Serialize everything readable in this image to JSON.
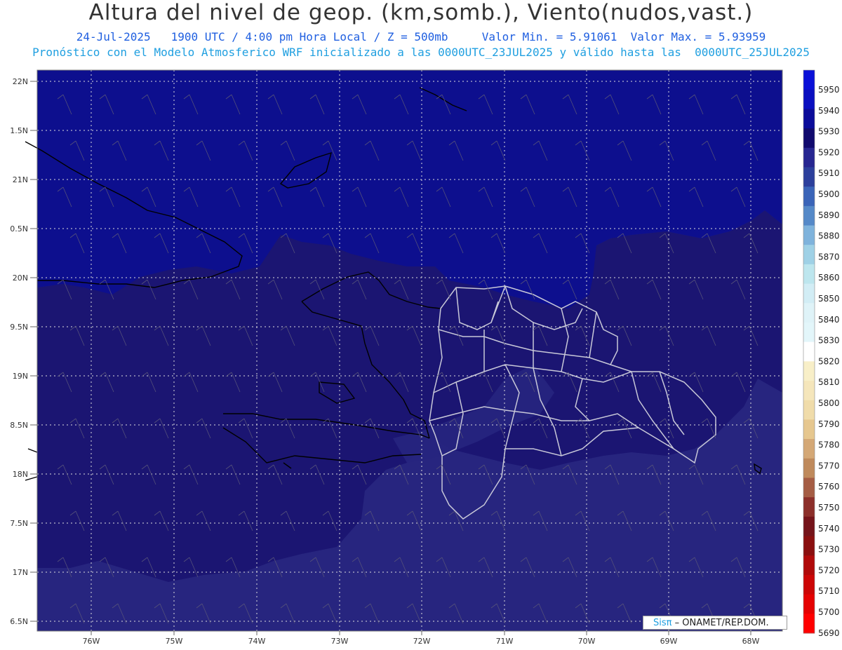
{
  "header": {
    "title": "Altura del nivel de geop. (km,somb.), Viento(nudos,vast.)",
    "line1_date": "24-Jul-2025",
    "line1_time": "1900 UTC / 4:00 pm Hora Local / Z = 500mb",
    "line1_min": "Valor Min. = 5.91061",
    "line1_max": "Valor Max. = 5.93959",
    "line2": "Pronóstico con el Modelo Atmosferico WRF inicializado a las 0000UTC_23JUL2025 y válido hasta las  0000UTC_25JUL2025"
  },
  "axes": {
    "lat_labels": [
      "22N",
      "1.5N",
      "21N",
      "0.5N",
      "20N",
      "9.5N",
      "19N",
      "8.5N",
      "18N",
      "7.5N",
      "17N",
      "6.5N"
    ],
    "lon_labels": [
      "76W",
      "75W",
      "74W",
      "73W",
      "72W",
      "71W",
      "70W",
      "69W",
      "68W"
    ]
  },
  "colorbar": {
    "levels": [
      5950,
      5940,
      5930,
      5920,
      5910,
      5900,
      5890,
      5880,
      5870,
      5860,
      5850,
      5840,
      5830,
      5820,
      5810,
      5800,
      5790,
      5780,
      5770,
      5760,
      5750,
      5740,
      5730,
      5720,
      5710,
      5700,
      5690
    ],
    "colors": [
      "#0a10d8",
      "#0a0fc0",
      "#0b0c9a",
      "#110a6e",
      "#272691",
      "#2c3f9c",
      "#3a64b8",
      "#5589c8",
      "#7fb3dc",
      "#9fd1e6",
      "#bde6ee",
      "#d2edf5",
      "#dff3f8",
      "#e3f6fa",
      "#ffffff",
      "#f8efc8",
      "#f5e6bb",
      "#f0dcaa",
      "#e6c78f",
      "#d4a876",
      "#bf8a5c",
      "#a55d44",
      "#8c2f2a",
      "#75141a",
      "#8a0f0f",
      "#b00a0a",
      "#cc0606",
      "#e50202",
      "#ff0000"
    ]
  },
  "fill_colors": {
    "north": "#0d0f8e",
    "middle": "#1b1572",
    "south": "#27257f"
  },
  "credit": {
    "sis": "Sisπ",
    "rest": " – ONAMET/REP.DOM."
  }
}
